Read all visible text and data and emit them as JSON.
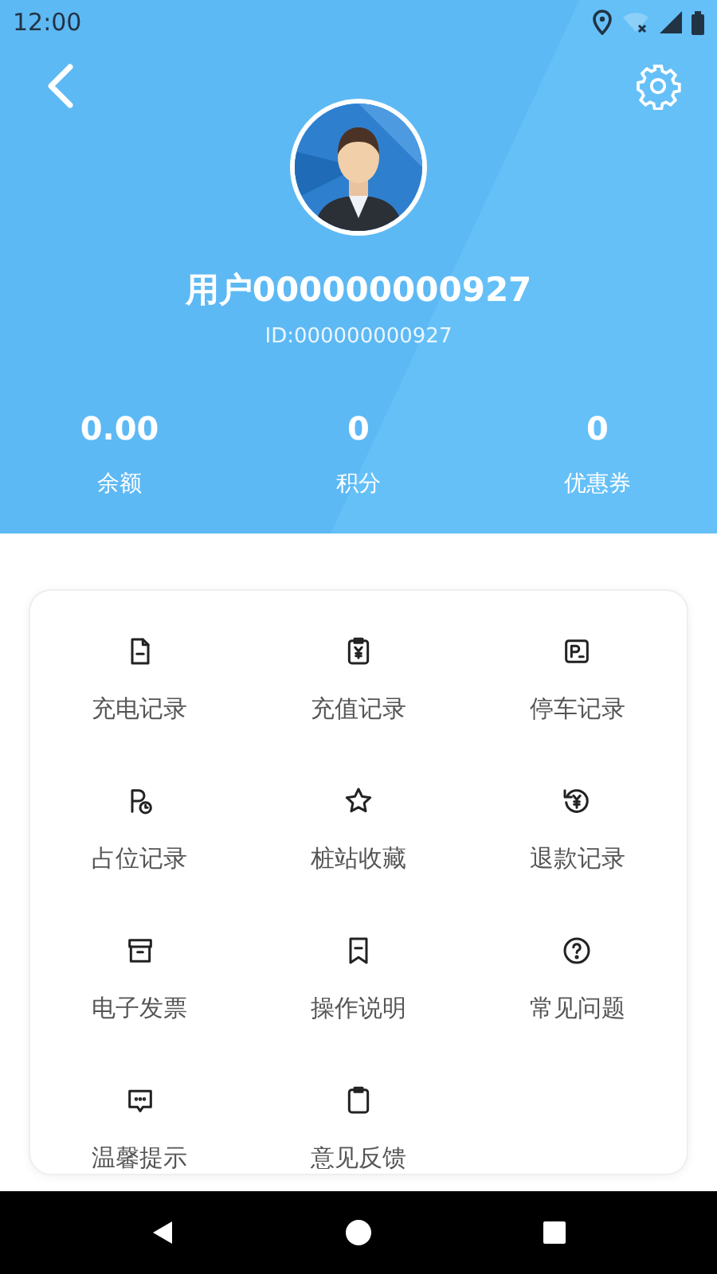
{
  "status_bar": {
    "time": "12:00"
  },
  "profile": {
    "name": "用户000000000927",
    "id": "ID:000000000927"
  },
  "stats": [
    {
      "value": "0.00",
      "label": "余额"
    },
    {
      "value": "0",
      "label": "积分"
    },
    {
      "value": "0",
      "label": "优惠券"
    }
  ],
  "menu": [
    {
      "label": "充电记录"
    },
    {
      "label": "充值记录"
    },
    {
      "label": "停车记录"
    },
    {
      "label": "占位记录"
    },
    {
      "label": "桩站收藏"
    },
    {
      "label": "退款记录"
    },
    {
      "label": "电子发票"
    },
    {
      "label": "操作说明"
    },
    {
      "label": "常见问题"
    },
    {
      "label": "温馨提示"
    },
    {
      "label": "意见反馈"
    }
  ]
}
